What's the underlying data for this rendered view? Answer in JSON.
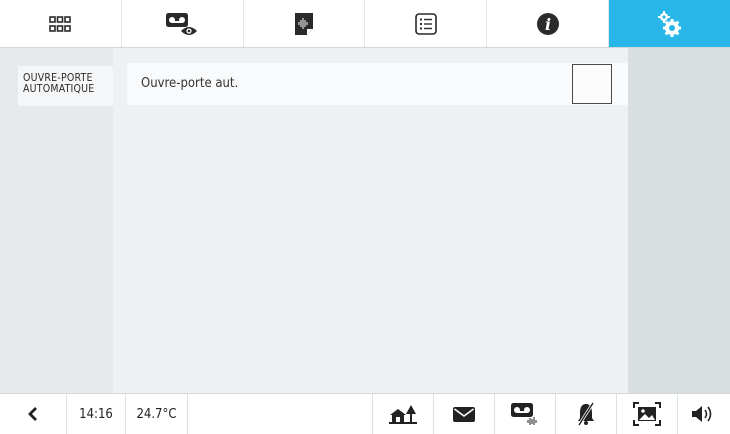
{
  "top_tabs": [
    {
      "id": "apps",
      "icon": "grid-icon"
    },
    {
      "id": "video-memo",
      "icon": "videomemo-eye-icon"
    },
    {
      "id": "voice-memo",
      "icon": "voicememo-icon"
    },
    {
      "id": "list",
      "icon": "list-icon"
    },
    {
      "id": "info",
      "icon": "info-icon"
    },
    {
      "id": "settings",
      "icon": "gears-icon",
      "active": true
    }
  ],
  "sidebar": {
    "items": [
      {
        "line1": "OUVRE-PORTE",
        "line2": "AUTOMATIQUE"
      }
    ]
  },
  "main": {
    "rows": [
      {
        "label": "Ouvre-porte aut.",
        "checked": false
      }
    ]
  },
  "status": {
    "time": "14:16",
    "temperature": "24.7°C"
  },
  "bottom_icons": [
    "back-icon",
    "home-tree-icon",
    "mail-icon",
    "videomemo-sound-icon",
    "mute-bell-icon",
    "picture-frame-icon",
    "speaker-icon"
  ],
  "colors": {
    "accent": "#29b6e8",
    "background": "#e6eaec"
  }
}
